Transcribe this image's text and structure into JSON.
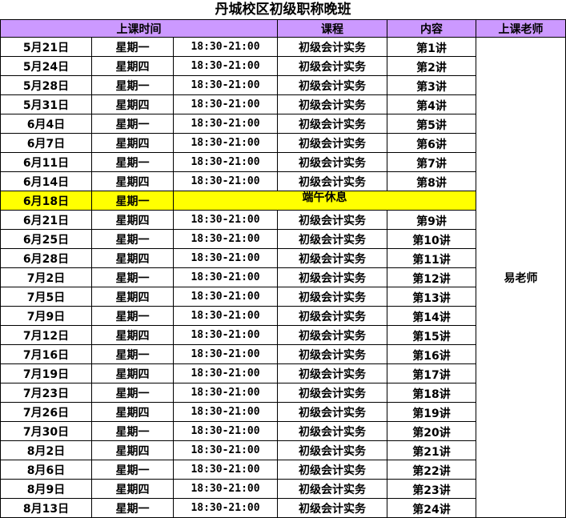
{
  "title": "丹城校区初级职称晚班",
  "headers": {
    "time": "上课时间",
    "course": "课程",
    "content": "内容",
    "teacher": "上课老师"
  },
  "teacher": "易老师",
  "holiday": {
    "date": "6月18日",
    "weekday": "星期一",
    "note": "端午休息"
  },
  "rows_before": [
    {
      "date": "5月21日",
      "weekday": "星期一",
      "time": "18:30-21:00",
      "course": "初级会计实务",
      "lecture": "第1讲"
    },
    {
      "date": "5月24日",
      "weekday": "星期四",
      "time": "18:30-21:00",
      "course": "初级会计实务",
      "lecture": "第2讲"
    },
    {
      "date": "5月28日",
      "weekday": "星期一",
      "time": "18:30-21:00",
      "course": "初级会计实务",
      "lecture": "第3讲"
    },
    {
      "date": "5月31日",
      "weekday": "星期四",
      "time": "18:30-21:00",
      "course": "初级会计实务",
      "lecture": "第4讲"
    },
    {
      "date": "6月4日",
      "weekday": "星期一",
      "time": "18:30-21:00",
      "course": "初级会计实务",
      "lecture": "第5讲"
    },
    {
      "date": "6月7日",
      "weekday": "星期四",
      "time": "18:30-21:00",
      "course": "初级会计实务",
      "lecture": "第6讲"
    },
    {
      "date": "6月11日",
      "weekday": "星期一",
      "time": "18:30-21:00",
      "course": "初级会计实务",
      "lecture": "第7讲"
    },
    {
      "date": "6月14日",
      "weekday": "星期四",
      "time": "18:30-21:00",
      "course": "初级会计实务",
      "lecture": "第8讲"
    }
  ],
  "rows_after": [
    {
      "date": "6月21日",
      "weekday": "星期四",
      "time": "18:30-21:00",
      "course": "初级会计实务",
      "lecture": "第9讲"
    },
    {
      "date": "6月25日",
      "weekday": "星期一",
      "time": "18:30-21:00",
      "course": "初级会计实务",
      "lecture": "第10讲"
    },
    {
      "date": "6月28日",
      "weekday": "星期四",
      "time": "18:30-21:00",
      "course": "初级会计实务",
      "lecture": "第11讲"
    },
    {
      "date": "7月2日",
      "weekday": "星期一",
      "time": "18:30-21:00",
      "course": "初级会计实务",
      "lecture": "第12讲"
    },
    {
      "date": "7月5日",
      "weekday": "星期四",
      "time": "18:30-21:00",
      "course": "初级会计实务",
      "lecture": "第13讲"
    },
    {
      "date": "7月9日",
      "weekday": "星期一",
      "time": "18:30-21:00",
      "course": "初级会计实务",
      "lecture": "第14讲"
    },
    {
      "date": "7月12日",
      "weekday": "星期四",
      "time": "18:30-21:00",
      "course": "初级会计实务",
      "lecture": "第15讲"
    },
    {
      "date": "7月16日",
      "weekday": "星期一",
      "time": "18:30-21:00",
      "course": "初级会计实务",
      "lecture": "第16讲"
    },
    {
      "date": "7月19日",
      "weekday": "星期四",
      "time": "18:30-21:00",
      "course": "初级会计实务",
      "lecture": "第17讲"
    },
    {
      "date": "7月23日",
      "weekday": "星期一",
      "time": "18:30-21:00",
      "course": "初级会计实务",
      "lecture": "第18讲"
    },
    {
      "date": "7月26日",
      "weekday": "星期四",
      "time": "18:30-21:00",
      "course": "初级会计实务",
      "lecture": "第19讲"
    },
    {
      "date": "7月30日",
      "weekday": "星期一",
      "time": "18:30-21:00",
      "course": "初级会计实务",
      "lecture": "第20讲"
    },
    {
      "date": "8月2日",
      "weekday": "星期四",
      "time": "18:30-21:00",
      "course": "初级会计实务",
      "lecture": "第21讲"
    },
    {
      "date": "8月6日",
      "weekday": "星期一",
      "time": "18:30-21:00",
      "course": "初级会计实务",
      "lecture": "第22讲"
    },
    {
      "date": "8月9日",
      "weekday": "星期四",
      "time": "18:30-21:00",
      "course": "初级会计实务",
      "lecture": "第23讲"
    },
    {
      "date": "8月13日",
      "weekday": "星期一",
      "time": "18:30-21:00",
      "course": "初级会计实务",
      "lecture": "第24讲"
    }
  ],
  "colors": {
    "header_bg": "#cc99ff",
    "holiday_bg": "#ffff00"
  }
}
